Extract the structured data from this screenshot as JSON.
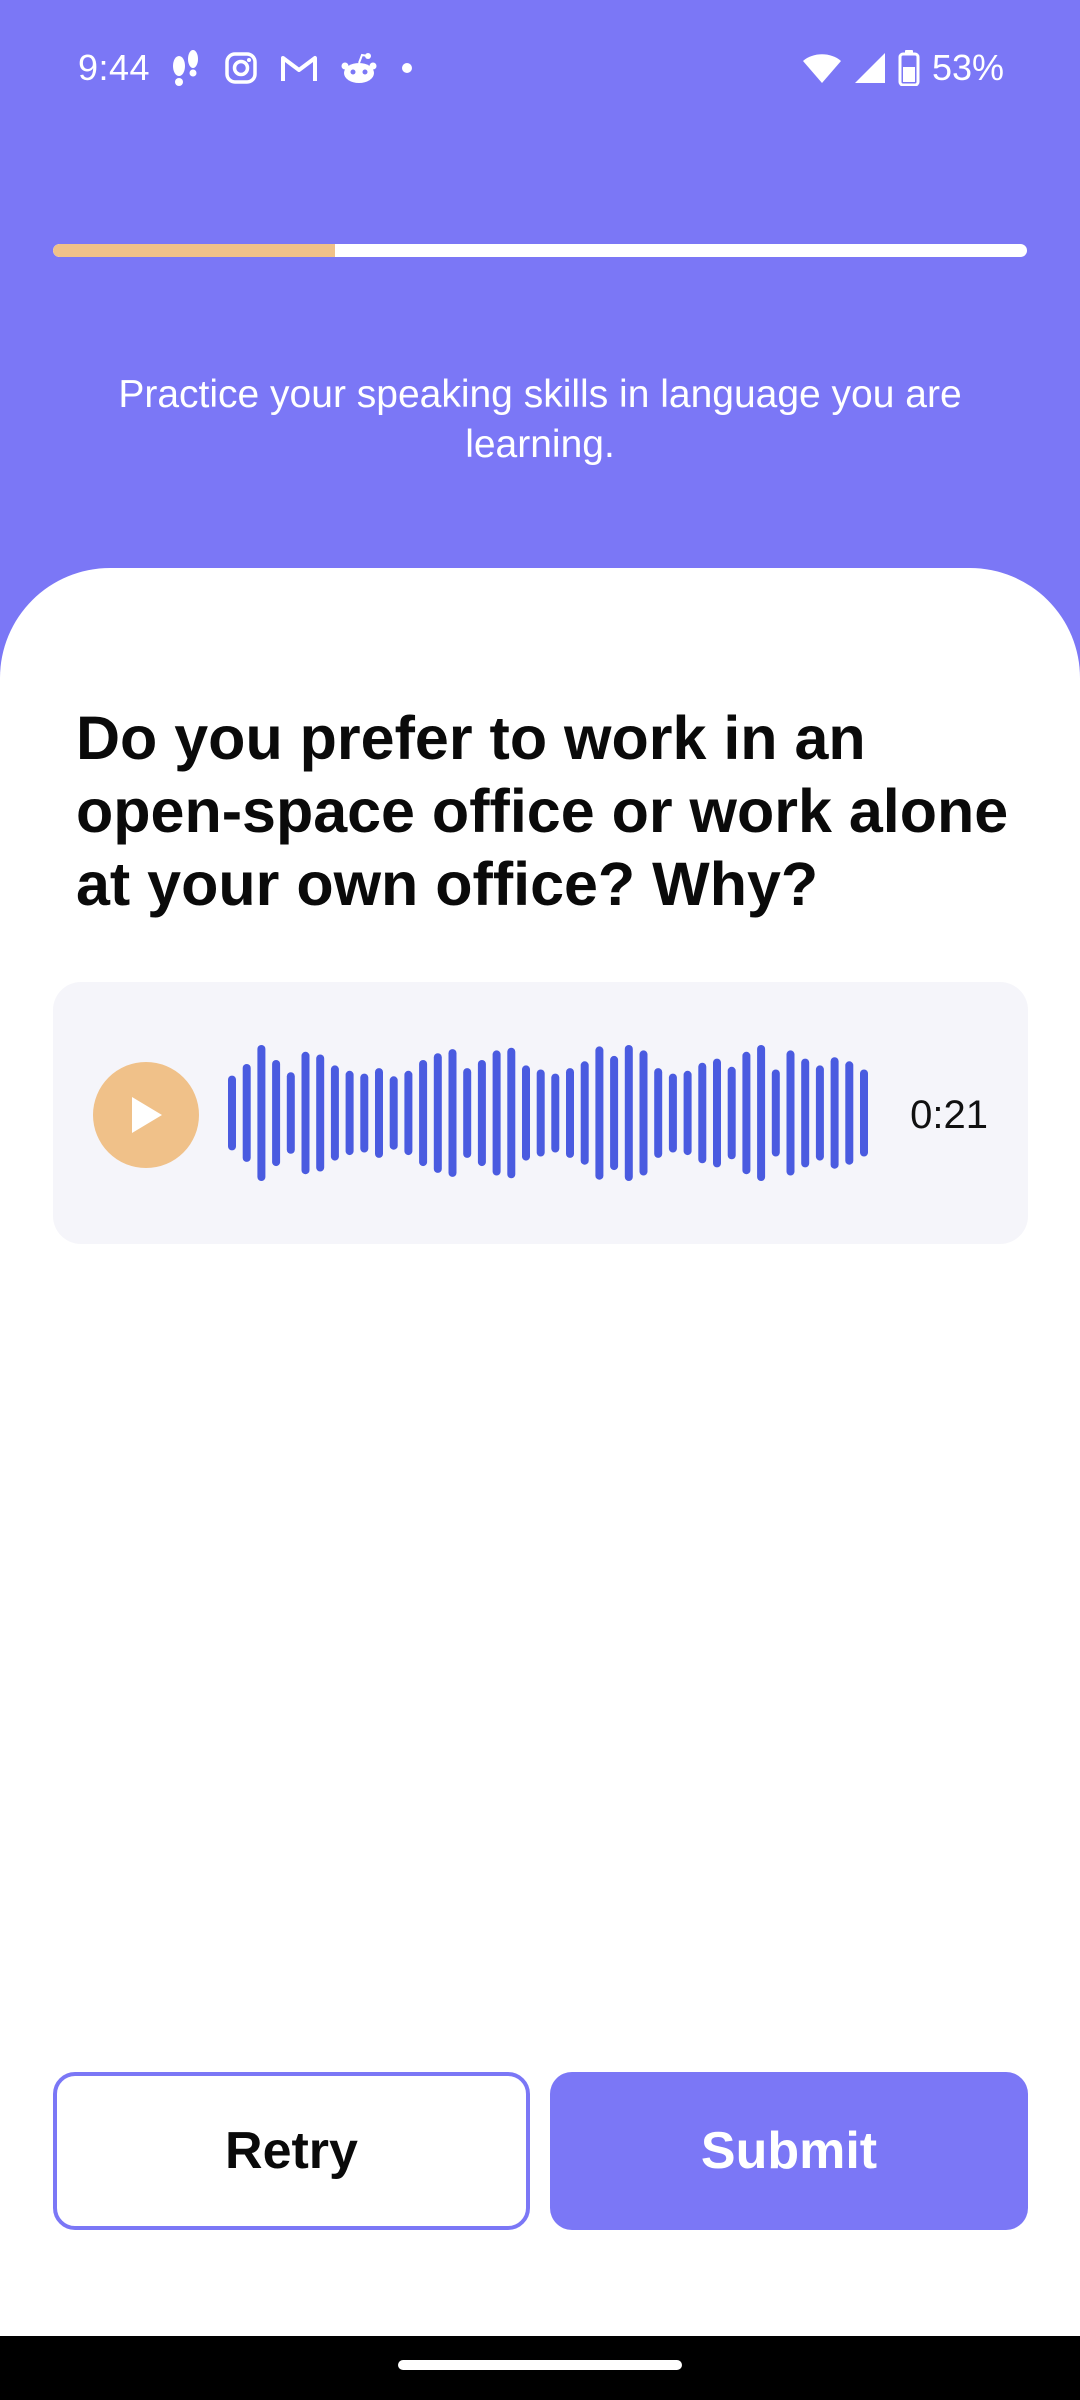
{
  "status_bar": {
    "time": "9:44",
    "battery_text": "53%",
    "left_icons": [
      "footprints-icon",
      "instagram-icon",
      "gmail-icon",
      "reddit-icon",
      "dot-icon"
    ],
    "right_icons": [
      "wifi-icon",
      "signal-icon",
      "battery-icon"
    ]
  },
  "progress": {
    "fraction": 0.29
  },
  "instruction": "Practice your speaking skills in language you are learning.",
  "question": "Do you prefer to work in an open-space office or work alone at your own office? Why?",
  "audio": {
    "duration": "0:21",
    "play_icon": "play-icon",
    "waveform_levels": [
      0.55,
      0.72,
      1.0,
      0.78,
      0.6,
      0.9,
      0.86,
      0.7,
      0.62,
      0.58,
      0.66,
      0.54,
      0.62,
      0.78,
      0.88,
      0.94,
      0.66,
      0.78,
      0.92,
      0.96,
      0.7,
      0.64,
      0.58,
      0.66,
      0.76,
      0.98,
      0.84,
      1.0,
      0.92,
      0.66,
      0.58,
      0.62,
      0.74,
      0.8,
      0.68,
      0.9,
      1.0,
      0.64,
      0.92,
      0.8,
      0.7,
      0.82,
      0.76,
      0.64
    ]
  },
  "buttons": {
    "retry": "Retry",
    "submit": "Submit"
  },
  "colors": {
    "brand": "#7B77F6",
    "accent": "#F0C189",
    "waveform": "#4A5BE0"
  }
}
